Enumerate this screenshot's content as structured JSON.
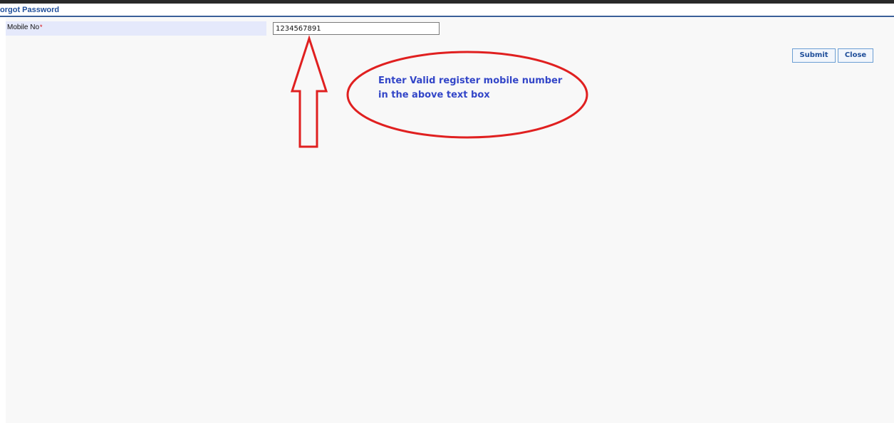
{
  "page": {
    "title": "orgot Password"
  },
  "form": {
    "mobile_label": "Mobile No",
    "required_marker": "*",
    "mobile_value": "1234567891"
  },
  "actions": {
    "submit_label": "Submit",
    "close_label": "Close"
  },
  "annotation": {
    "note": "Enter Valid register mobile number in the above text box",
    "color": "#e02020",
    "text_color": "#3346c8"
  },
  "colors": {
    "title": "#1f4e9a",
    "rule": "#3a5f98",
    "label_row": "#e5e9fb",
    "background": "#f8f8f8"
  }
}
